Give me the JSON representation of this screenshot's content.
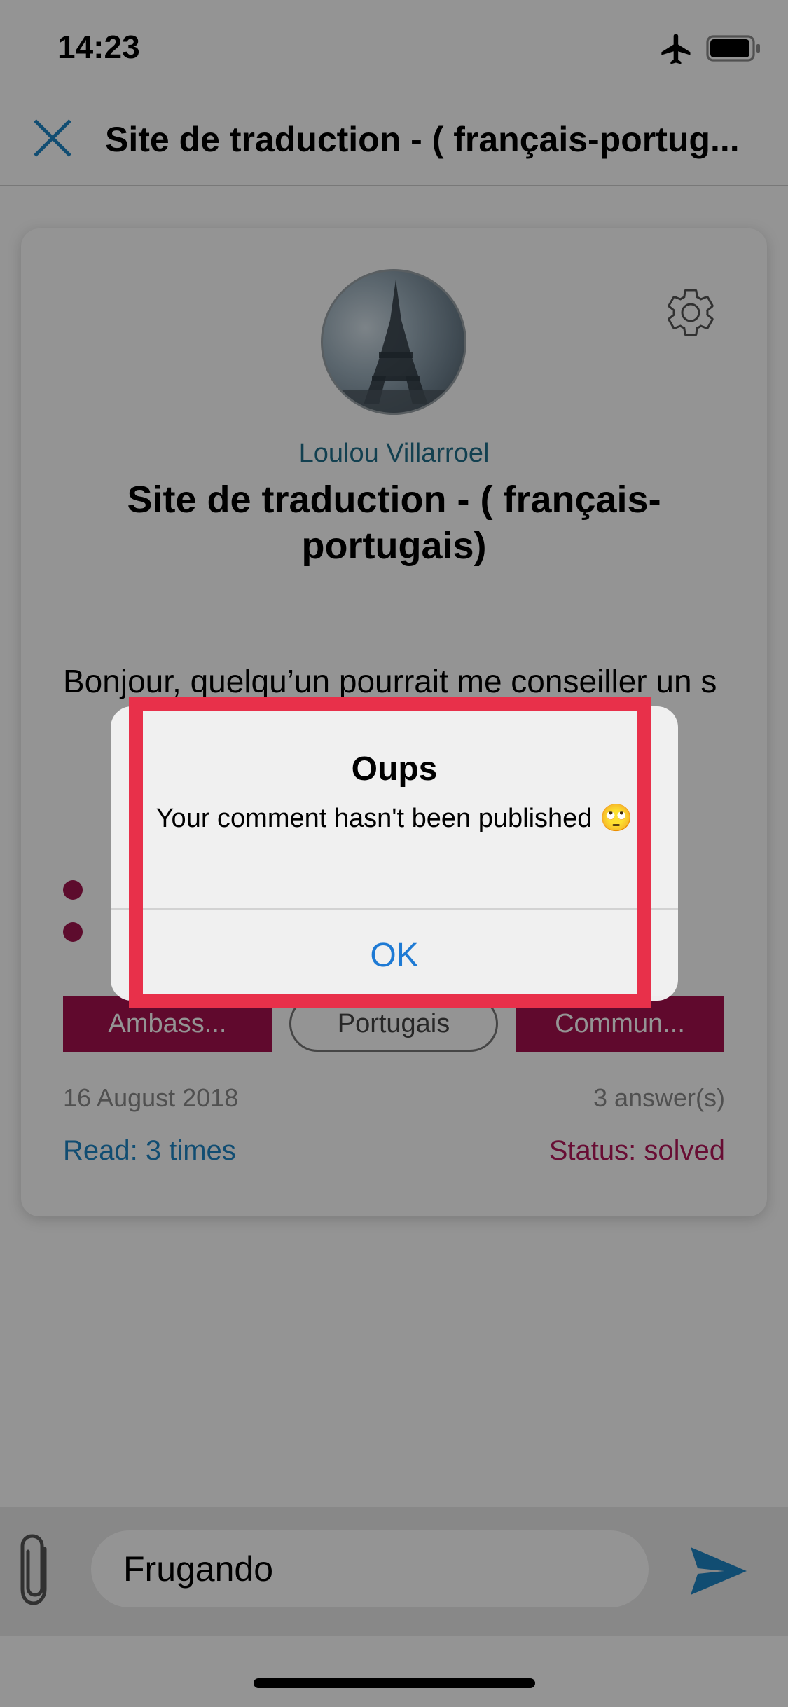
{
  "status_bar": {
    "time": "14:23"
  },
  "nav": {
    "title": "Site de traduction  - ( français-portug..."
  },
  "card": {
    "author": "Loulou Villarroel",
    "title": "Site de traduction  - ( français-portugais)",
    "body": "Bonjour, quelqu’un pourrait me conseiller un s",
    "tags": [
      "Ambass...",
      "Portugais",
      "Commun..."
    ],
    "date": "16 August 2018",
    "answers": "3 answer(s)",
    "read": "Read: 3 times",
    "status": "Status: solved"
  },
  "composer": {
    "value": "Frugando"
  },
  "alert": {
    "title": "Oups",
    "message": "Your comment hasn't been published 🙄",
    "ok_label": "OK"
  },
  "colors": {
    "accent_blue": "#1e85c4",
    "tag_magenta": "#a5114f",
    "highlight_red": "#e8304a"
  },
  "icons": [
    "airplane-icon",
    "battery-icon",
    "close-icon",
    "gear-icon",
    "paperclip-icon",
    "send-icon"
  ]
}
